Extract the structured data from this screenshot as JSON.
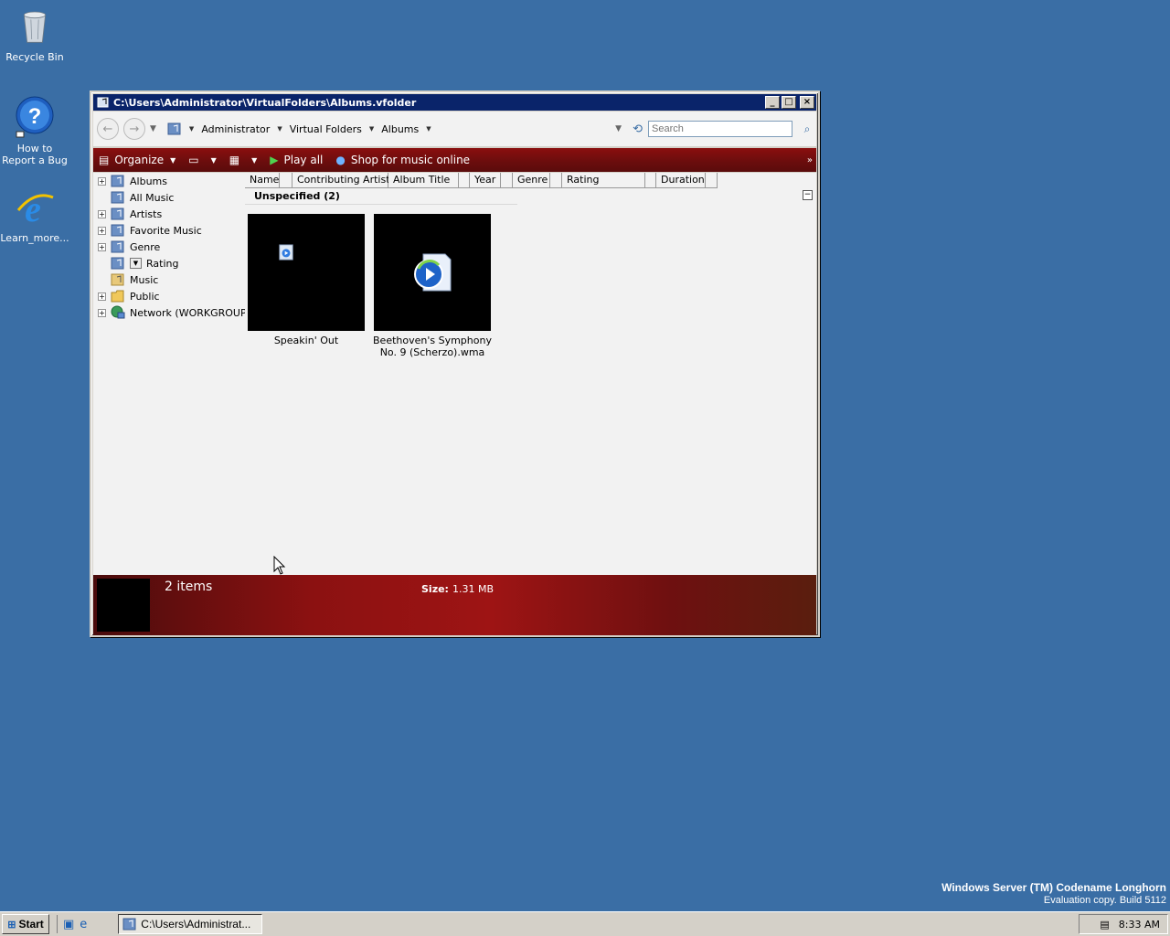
{
  "desktop": {
    "icons": [
      {
        "label": "Recycle Bin",
        "icon": "recycle-bin-icon"
      },
      {
        "label": "How to Report a Bug",
        "icon": "help-icon"
      },
      {
        "label": "Learn_more...",
        "icon": "internet-explorer-icon"
      }
    ],
    "watermark_line1": "Windows Server (TM) Codename Longhorn",
    "watermark_line2": "Evaluation copy. Build 5112"
  },
  "window": {
    "title": "C:\\Users\\Administrator\\VirtualFolders\\Albums.vfolder",
    "controls": {
      "minimize": "_",
      "maximize": "□",
      "close": "×"
    },
    "address": {
      "crumbs": [
        "Administrator",
        "Virtual Folders",
        "Albums"
      ],
      "search_placeholder": "Search"
    },
    "commands": {
      "organize": "Organize",
      "play_all": "Play all",
      "shop": "Shop for music online",
      "overflow": "»"
    },
    "nav": {
      "items": [
        {
          "label": "Albums",
          "expander": "+"
        },
        {
          "label": "All Music",
          "expander": ""
        },
        {
          "label": "Artists",
          "expander": "+"
        },
        {
          "label": "Favorite Music",
          "expander": "+"
        },
        {
          "label": "Genre",
          "expander": "+"
        },
        {
          "label": "Rating",
          "expander": ""
        },
        {
          "label": "Music",
          "expander": ""
        },
        {
          "label": "Public",
          "expander": "+"
        },
        {
          "label": "Network (WORKGROUP)",
          "expander": "+"
        }
      ]
    },
    "columns": [
      "Name",
      "Contributing Artist",
      "Album Title",
      "Year",
      "Genre",
      "Rating",
      "Duration"
    ],
    "group": {
      "title": "Unspecified (2)",
      "collapse": "−"
    },
    "tiles": [
      {
        "label": "Speakin' Out"
      },
      {
        "label": "Beethoven's Symphony No. 9 (Scherzo).wma"
      }
    ],
    "details": {
      "count": "2 items",
      "size_label": "Size:",
      "size_value": "1.31 MB"
    }
  },
  "taskbar": {
    "start": "Start",
    "task_label": "C:\\Users\\Administrat...",
    "clock": "8:33 AM"
  },
  "colors": {
    "desktop": "#3a6ea5",
    "titlebar": "#0a246a",
    "command_bar": "#7a0e0e",
    "details_pane": "#8b1111"
  }
}
